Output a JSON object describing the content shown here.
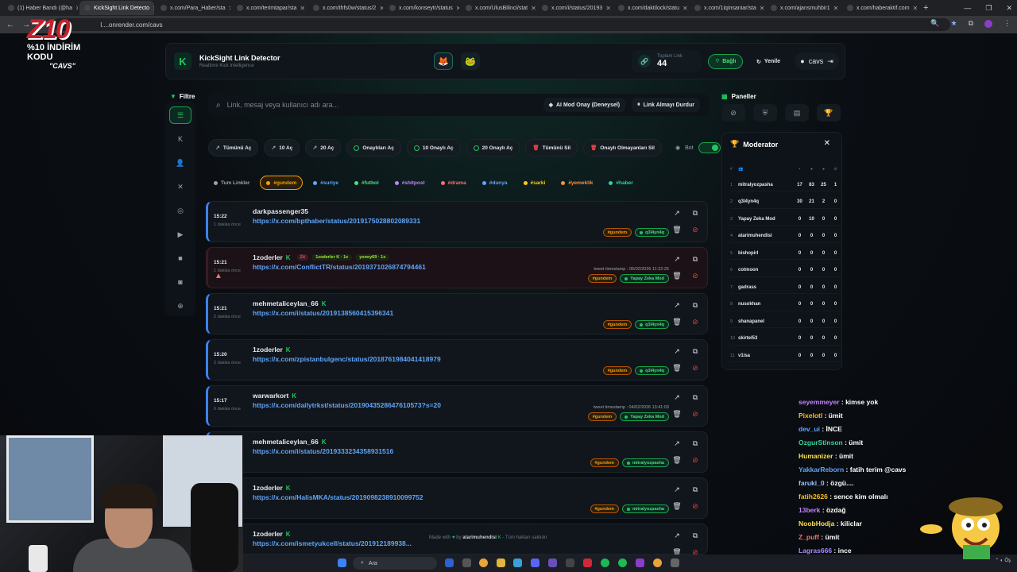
{
  "browser": {
    "tabs": [
      {
        "title": "(1) Haber Bandı (@ha"
      },
      {
        "title": "KickSight Link Detecto",
        "active": true
      },
      {
        "title": "x.com/Para_Haber/sta"
      },
      {
        "title": "x.com/terimtapar/sta"
      },
      {
        "title": "x.com/thfs0w/status/2"
      },
      {
        "title": "x.com/konseytr/status"
      },
      {
        "title": "x.com/UlusBilinci/stat"
      },
      {
        "title": "x.com/i/status/20193"
      },
      {
        "title": "x.com/daktilock/statu"
      },
      {
        "title": "x.com/1iqinsaniar/sta"
      },
      {
        "title": "x.com/ajansmuhbir1"
      },
      {
        "title": "x.com/haberaktif.com"
      }
    ],
    "new_tab": "+",
    "url": "l....onrender.com/cavs"
  },
  "overlay": {
    "logo": "Z10",
    "line1": "%10 İNDİRİM KODU",
    "line2": "\"CAVS\""
  },
  "header": {
    "title": "KickSight Link Detector",
    "subtitle": "Realtime Kick Intelligence",
    "emoji1": "🦊",
    "emoji2": "🐸",
    "stat_label": "Toplam Link",
    "stat_value": "44",
    "connect_label": "Bağlı",
    "refresh_label": "Yenile",
    "user_label": "cavs"
  },
  "filter_label": "Filtre",
  "search": {
    "placeholder": "Link, mesaj veya kullanıcı adı ara...",
    "ai_mode": "AI Mod Onay (Deneysel)",
    "stop": "Link Almayı Durdur"
  },
  "actions": {
    "open_all": "Tümünü Aç",
    "open_10": "10 Aç",
    "open_20": "20 Aç",
    "open_approved": "Onaylıları Aç",
    "open_10_approved": "10 Onaylı Aç",
    "open_20_approved": "20 Onaylı Aç",
    "delete_all": "Tümünü Sil",
    "delete_unapproved": "Onaylı Olmayanları Sil",
    "bot": "Bot"
  },
  "tags": [
    {
      "label": "Tum Linkler",
      "color": "#9aa3ad"
    },
    {
      "label": "#gundem",
      "color": "#f59e0b",
      "selected": true
    },
    {
      "label": "#suriye",
      "color": "#60a5fa"
    },
    {
      "label": "#futbol",
      "color": "#4ade80"
    },
    {
      "label": "#shitpost",
      "color": "#c084fc"
    },
    {
      "label": "#drama",
      "color": "#f87171"
    },
    {
      "label": "#dunya",
      "color": "#60a5fa"
    },
    {
      "label": "#sarki",
      "color": "#facc15"
    },
    {
      "label": "#yemeklik",
      "color": "#fb923c"
    },
    {
      "label": "#haber",
      "color": "#34d399"
    }
  ],
  "feed": [
    {
      "time": "15:22",
      "ago": "1 dakika önce",
      "user": "darkpassenger35",
      "kick": false,
      "link": "https://x.com/bpthaber/status/2019175028802089331",
      "tag": "#gundem",
      "mod": "q3l4yn4q"
    },
    {
      "time": "15:21",
      "ago": "1 dakika önce",
      "user": "1zoderler",
      "kick": true,
      "count": "2x",
      "user2": "1zoderler K · 1x",
      "user3": "yoney69 · 1x",
      "link": "https://x.com/ConflictTR/status/2019371026874794461",
      "timestamp": "tweet timestamp : 05/02/2026 11:22:25",
      "tag": "#gundem",
      "mod": "Yapay Zeka Mod",
      "alert": true
    },
    {
      "time": "15:21",
      "ago": "2 dakika önce",
      "user": "mehmetaliceylan_66",
      "kick": true,
      "link": "https://x.com/i/status/2019138560415396341",
      "tag": "#gundem",
      "mod": "q3l4yn4q"
    },
    {
      "time": "15:20",
      "ago": "2 dakika önce",
      "user": "1zoderler",
      "kick": true,
      "link": "https://x.com/zpistanbulgenc/status/2018761984041418979",
      "tag": "#gundem",
      "mod": "q3l4yn4q"
    },
    {
      "time": "15:17",
      "ago": "6 dakika önce",
      "user": "warwarkort",
      "kick": true,
      "link": "https://x.com/dailytrkst/status/2019043528647610573?s=20",
      "timestamp": "tweet timestamp : 04/02/2026 13:41:03",
      "tag": "#gundem",
      "mod": "Yapay Zeka Mod"
    },
    {
      "time": "",
      "ago": "",
      "user": "mehmetaliceylan_66",
      "kick": true,
      "link": "https://x.com/i/status/2019333234358931516",
      "tag": "#gundem",
      "mod": "mitralyozpasha"
    },
    {
      "time": "",
      "ago": "",
      "user": "1zoderler",
      "kick": true,
      "link": "https://x.com/HalisMKA/status/2019098238910099752",
      "tag": "#gundem",
      "mod": "mitralyozpasha"
    },
    {
      "time": "",
      "ago": "",
      "user": "1zoderler",
      "kick": true,
      "link": "https://x.com/ismetyukcell/status/201912189938...",
      "tag": "",
      "mod": ""
    }
  ],
  "panels": {
    "label": "Paneller"
  },
  "moderator": {
    "title": "Moderator",
    "rows": [
      {
        "rank": "1",
        "name": "mitralyozpasha",
        "a": "17",
        "b": "83",
        "c": "25",
        "d": "1"
      },
      {
        "rank": "2",
        "name": "q3l4yn4q",
        "a": "30",
        "b": "21",
        "c": "2",
        "d": "0"
      },
      {
        "rank": "3",
        "name": "Yapay Zeka Mod",
        "a": "0",
        "b": "10",
        "c": "0",
        "d": "0"
      },
      {
        "rank": "4",
        "name": "atarimuhendisi",
        "a": "0",
        "b": "0",
        "c": "0",
        "d": "0"
      },
      {
        "rank": "5",
        "name": "bishopirl",
        "a": "0",
        "b": "0",
        "c": "0",
        "d": "0"
      },
      {
        "rank": "6",
        "name": "cotmoon",
        "a": "0",
        "b": "0",
        "c": "0",
        "d": "0"
      },
      {
        "rank": "7",
        "name": "gadrass",
        "a": "0",
        "b": "0",
        "c": "0",
        "d": "0"
      },
      {
        "rank": "8",
        "name": "nusokhan",
        "a": "0",
        "b": "0",
        "c": "0",
        "d": "0"
      },
      {
        "rank": "9",
        "name": "shanapanel",
        "a": "0",
        "b": "0",
        "c": "0",
        "d": "0"
      },
      {
        "rank": "10",
        "name": "skirtel53",
        "a": "0",
        "b": "0",
        "c": "0",
        "d": "0"
      },
      {
        "rank": "11",
        "name": "v1isa",
        "a": "0",
        "b": "0",
        "c": "0",
        "d": "0"
      }
    ]
  },
  "chat": [
    {
      "user": "seyemmeyer",
      "msg": "kimse yok",
      "color": "#c084fc"
    },
    {
      "user": "Pixelotl",
      "msg": "ümit",
      "color": "#fbbf24"
    },
    {
      "user": "dev_ui",
      "msg": "İNCE",
      "color": "#60a5fa"
    },
    {
      "user": "OzgurStinson",
      "msg": "ümit",
      "color": "#34d399"
    },
    {
      "user": "Humanizer",
      "msg": "ümit",
      "color": "#fde047"
    },
    {
      "user": "YakkarReborn",
      "msg": "fatih terim @cavs",
      "color": "#60a5fa"
    },
    {
      "user": "faruki_0",
      "msg": "özgü....",
      "color": "#93c5fd"
    },
    {
      "user": "fatih2626",
      "msg": "sence kim olmalı",
      "color": "#fbbf24"
    },
    {
      "user": "13berk",
      "msg": "özdağ",
      "color": "#c084fc"
    },
    {
      "user": "NoobHodja",
      "msg": "kiliclar",
      "color": "#fde047"
    },
    {
      "user": "Z_puff",
      "msg": "ümit",
      "color": "#f87171"
    },
    {
      "user": "Lagras666",
      "msg": "ince",
      "color": "#a78bfa"
    }
  ],
  "footer": {
    "made_with": "Made with",
    "by": "by",
    "author": "atarimuhendisi",
    "rights": "- Tüm hakları saklıdır"
  },
  "taskbar": {
    "search": "Ara"
  }
}
